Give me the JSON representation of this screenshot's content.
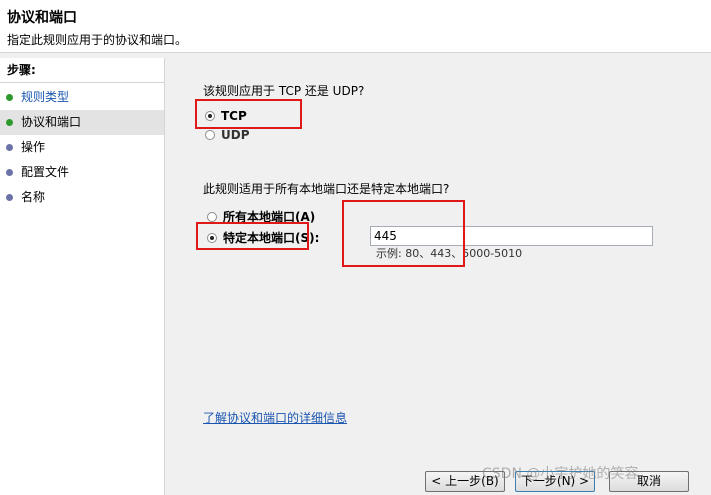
{
  "header": {
    "title": "协议和端口",
    "subtitle": "指定此规则应用于的协议和端口。"
  },
  "sidebar": {
    "steps_title": "步骤:",
    "items": [
      {
        "label": "规则类型"
      },
      {
        "label": "协议和端口"
      },
      {
        "label": "操作"
      },
      {
        "label": "配置文件"
      },
      {
        "label": "名称"
      }
    ]
  },
  "protocol": {
    "question": "该规则应用于 TCP 还是 UDP?",
    "options": [
      {
        "label": "TCP",
        "checked": true
      },
      {
        "label": "UDP",
        "checked": false
      }
    ]
  },
  "ports": {
    "question": "此规则适用于所有本地端口还是特定本地端口?",
    "options": [
      {
        "label": "所有本地端口(A)",
        "checked": false
      },
      {
        "label": "特定本地端口(S):",
        "checked": true
      }
    ],
    "input_value": "445",
    "example": "示例: 80、443、5000-5010"
  },
  "link": {
    "label": "了解协议和端口的详细信息"
  },
  "buttons": {
    "back": "< 上一步(B)",
    "next": "下一步(N) >",
    "cancel": "取消"
  },
  "watermark": "CSDN @小宇护她的笑容",
  "colors": {
    "highlight_box": "#e01818",
    "link": "#1a55b0",
    "step_done": "#2e9a2e",
    "step_pending": "#6b72a8"
  }
}
